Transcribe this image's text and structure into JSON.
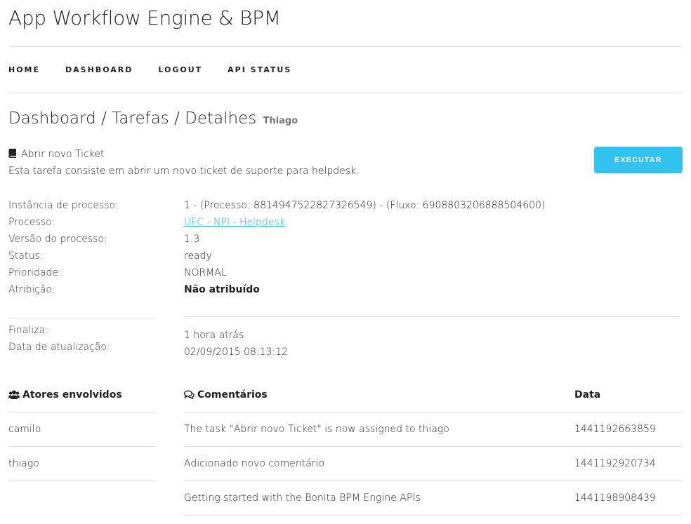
{
  "app": {
    "title": "App Workflow Engine & BPM"
  },
  "nav": {
    "items": [
      {
        "label": "HOME"
      },
      {
        "label": "DASHBOARD"
      },
      {
        "label": "LOGOUT"
      },
      {
        "label": "API STATUS"
      }
    ]
  },
  "page": {
    "title": "Dashboard / Tarefas / Detalhes",
    "user": "Thiago"
  },
  "task": {
    "icon": "book-icon",
    "name": "Abrir novo Ticket",
    "description": "Esta tarefa consiste em abrir um novo ticket de suporte para helpdesk.",
    "execute_label": "EXECUTAR"
  },
  "details": [
    {
      "label": "Instância de processo:",
      "value": "1 - (Processo: 8814947522827326549) - (Fluxo: 6908803206888504600)"
    },
    {
      "label": "Processo:",
      "value": "UFC - NPI - Helpdesk"
    },
    {
      "label": "Versão do processo:",
      "value": "1.3"
    },
    {
      "label": "Status:",
      "value": "ready"
    },
    {
      "label": "Prioridade:",
      "value": "NORMAL"
    },
    {
      "label": "Atribição:",
      "value": "Não atribuído"
    }
  ],
  "dates": {
    "finaliza_label": "Finaliza:",
    "updated_label": "Data de atualização:",
    "finaliza_value": "1 hora atrás",
    "updated_value": "02/09/2015 08:13:12"
  },
  "actors": {
    "icon": "users-icon",
    "header": "Atores envolvidos",
    "items": [
      "camilo",
      "thiago"
    ]
  },
  "comments": {
    "icon": "comments-icon",
    "header": "Comentários",
    "date_header": "Data",
    "rows": [
      {
        "text": "The task \"Abrir novo Ticket\" is now assigned to thiago",
        "date": "1441192663859"
      },
      {
        "text": "Adicionado novo comentário",
        "date": "1441192920734"
      },
      {
        "text": "Getting started with the Bonita BPM Engine APIs",
        "date": "1441198908439"
      }
    ]
  },
  "colors": {
    "accent": "#33c3f0",
    "link": "#1eaedb",
    "divider": "#e1e1e1",
    "muted": "#777777"
  }
}
